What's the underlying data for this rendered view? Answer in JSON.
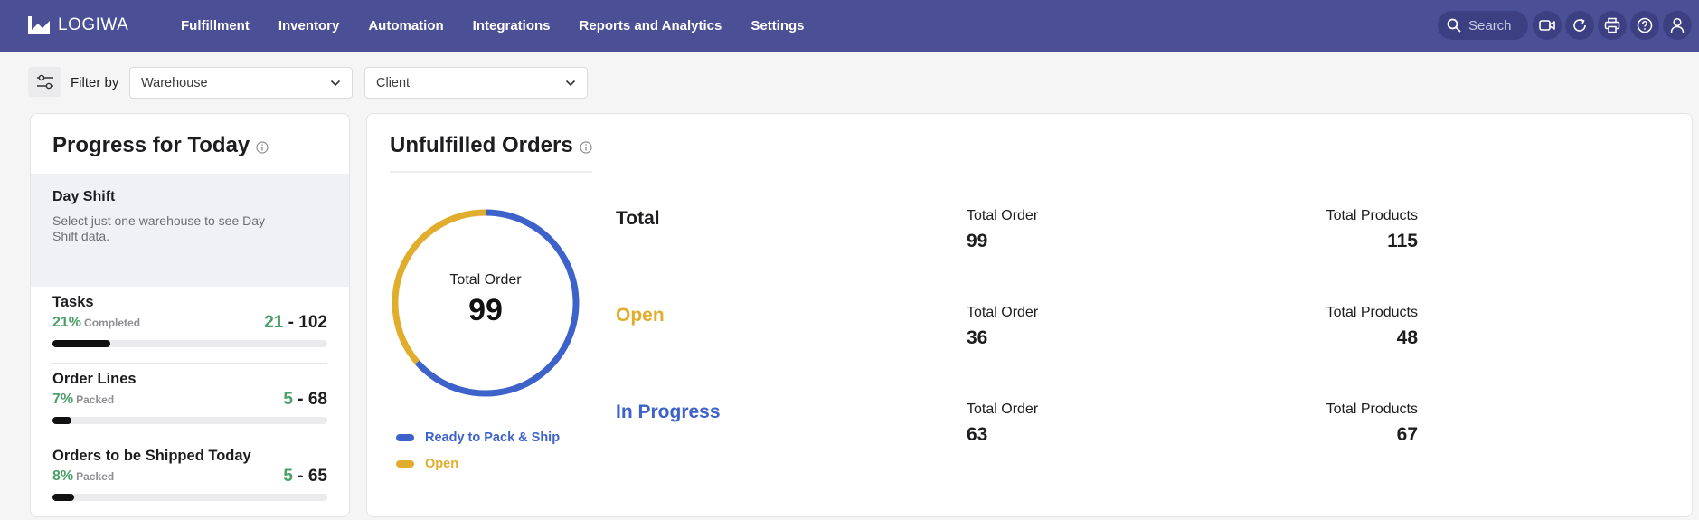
{
  "brand": {
    "name": "LOGIWA"
  },
  "nav": {
    "items": [
      {
        "label": "Fulfillment"
      },
      {
        "label": "Inventory"
      },
      {
        "label": "Automation"
      },
      {
        "label": "Integrations"
      },
      {
        "label": "Reports and Analytics"
      },
      {
        "label": "Settings"
      }
    ],
    "search_placeholder": "Search",
    "icons": [
      "video-icon",
      "refresh-icon",
      "print-icon",
      "help-icon",
      "user-icon"
    ]
  },
  "filters": {
    "label": "Filter by",
    "warehouse": "Warehouse",
    "client": "Client"
  },
  "progress": {
    "title": "Progress for Today",
    "shift": {
      "title": "Day Shift",
      "description": "Select just one warehouse to see Day Shift data."
    },
    "metrics": [
      {
        "name": "Tasks",
        "percent": "21%",
        "status": "Completed",
        "done": "21",
        "total": "102",
        "fraction": 0.21
      },
      {
        "name": "Order Lines",
        "percent": "7%",
        "status": "Packed",
        "done": "5",
        "total": "68",
        "fraction": 0.07
      },
      {
        "name": "Orders to be Shipped Today",
        "percent": "8%",
        "status": "Packed",
        "done": "5",
        "total": "65",
        "fraction": 0.08
      }
    ]
  },
  "unfulfilled": {
    "title": "Unfulfilled Orders",
    "donut": {
      "label": "Total Order",
      "value": "99",
      "segments": [
        {
          "name": "Ready to Pack & Ship",
          "value": 63,
          "color": "#3d62c9"
        },
        {
          "name": "Open",
          "value": 36,
          "color": "#e0ae2c"
        }
      ]
    },
    "legend": [
      {
        "label": "Ready to Pack & Ship",
        "color": "#3d62c9"
      },
      {
        "label": "Open",
        "color": "#e0ae2c"
      }
    ],
    "rows": [
      {
        "label": "Total",
        "color": "#1d1d1f",
        "order_label": "Total Order",
        "orders": "99",
        "products_label": "Total Products",
        "products": "115"
      },
      {
        "label": "Open",
        "color": "#e0ae2c",
        "order_label": "Total Order",
        "orders": "36",
        "products_label": "Total Products",
        "products": "48"
      },
      {
        "label": "In Progress",
        "color": "#3d62c9",
        "order_label": "Total Order",
        "orders": "63",
        "products_label": "Total Products",
        "products": "67"
      }
    ]
  },
  "colors": {
    "nav_bg": "#4a4f96",
    "success": "#4a9f68",
    "open": "#e0ae2c",
    "in_progress": "#3d62c9"
  }
}
